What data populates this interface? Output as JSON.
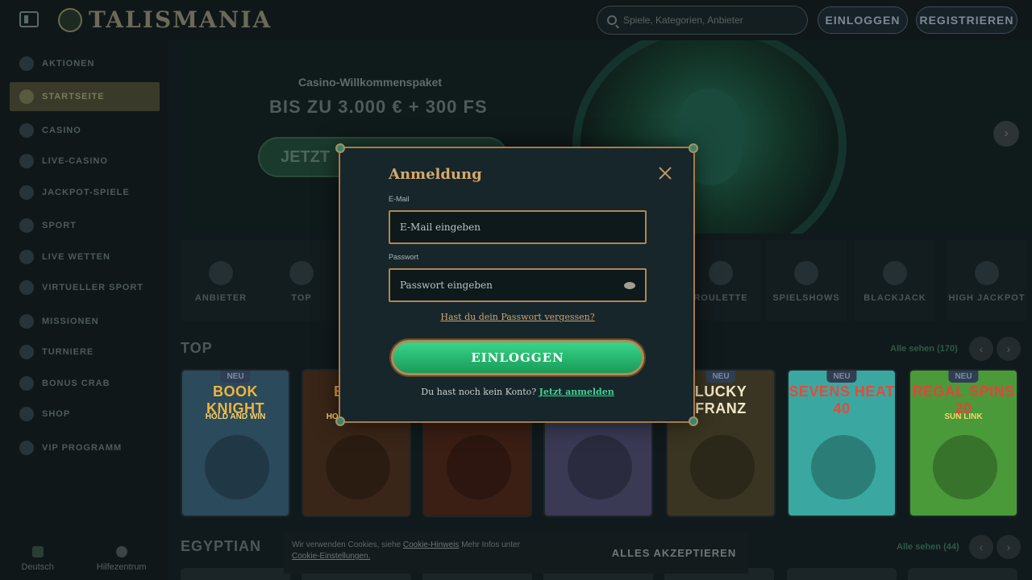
{
  "header": {
    "brand": "TALISMANIA",
    "search_placeholder": "Spiele, Kategorien, Anbieter",
    "login_label": "EINLOGGEN",
    "register_label": "REGISTRIEREN"
  },
  "sidebar": {
    "items": [
      {
        "label": "AKTIONEN",
        "icon": "gift-icon"
      },
      {
        "label": "STARTSEITE",
        "icon": "home-icon",
        "active": true
      },
      {
        "label": "CASINO",
        "icon": "casino-icon"
      },
      {
        "label": "LIVE-CASINO",
        "icon": "live-casino-icon"
      },
      {
        "label": "JACKPOT-SPIELE",
        "icon": "jackpot-icon"
      },
      {
        "label": "SPORT",
        "icon": "sport-icon"
      },
      {
        "label": "LIVE WETTEN",
        "icon": "live-bet-icon"
      },
      {
        "label": "VIRTUELLER SPORT",
        "icon": "virtual-sport-icon"
      },
      {
        "label": "MISSIONEN",
        "icon": "missions-icon"
      },
      {
        "label": "TURNIERE",
        "icon": "trophy-icon"
      },
      {
        "label": "BONUS CRAB",
        "icon": "crab-icon"
      },
      {
        "label": "SHOP",
        "icon": "shop-icon"
      },
      {
        "label": "VIP PROGRAMM",
        "icon": "diamond-icon"
      }
    ],
    "footer": {
      "language": "Deutsch",
      "help": "Hilfezentrum"
    }
  },
  "hero": {
    "subtitle": "Casino-Willkommenspaket",
    "title": "BIS ZU 3.000 € + 300 FS",
    "cta": "JETZT"
  },
  "categories": [
    {
      "label": "ANBIETER"
    },
    {
      "label": "TOP"
    },
    {
      "label": "ROULETTE"
    },
    {
      "label": "SPIELSHOWS"
    },
    {
      "label": "BLACKJACK"
    },
    {
      "label": "HIGH JACKPOT"
    }
  ],
  "top_section": {
    "title": "TOP",
    "see_all": "Alle sehen (170)"
  },
  "games": [
    {
      "badge": "NEU",
      "name": "BOOK KNIGHT",
      "sub": "HOLD AND WIN",
      "bg": "#2b4a5c",
      "name_color": "#f0b43b"
    },
    {
      "badge": "",
      "name": "BOOK",
      "sub": "HOLD AND WIN",
      "bg": "#3a2618",
      "name_color": "#e0a040"
    },
    {
      "badge": "",
      "name": "",
      "sub": "",
      "bg": "#3b1e14",
      "name_color": "#d08040"
    },
    {
      "badge": "",
      "name": "",
      "sub": "",
      "bg": "#3a3a55",
      "name_color": "#c0c0e0"
    },
    {
      "badge": "NEU",
      "name": "LUCKY FRANZ",
      "sub": "",
      "bg": "#3a3522",
      "name_color": "#f2e7c8"
    },
    {
      "badge": "NEU",
      "name": "SEVENS HEAT 40",
      "sub": "",
      "bg": "#3aa8a0",
      "name_color": "#e54a3a"
    },
    {
      "badge": "NEU",
      "name": "REGAL SPINS 20",
      "sub": "SUN LINK",
      "bg": "#4a9a3a",
      "name_color": "#e8423a"
    }
  ],
  "egyptian_section": {
    "title": "EGYPTIAN",
    "see_all": "Alle sehen (44)"
  },
  "cookie": {
    "text_prefix": "Wir verwenden Cookies, siehe",
    "link1": "Cookie-Hinweis",
    "text_mid": "Mehr Infos unter",
    "link2": "Cookie-Einstellungen.",
    "accept": "ALLES AKZEPTIEREN"
  },
  "login_modal": {
    "title": "Anmeldung",
    "email_label": "E-Mail",
    "email_placeholder": "E-Mail eingeben",
    "email_value": "",
    "password_label": "Passwort",
    "password_placeholder": "Passwort eingeben",
    "password_value": "",
    "forgot": "Hast du dein Passwort vergessen?",
    "submit": "EINLOGGEN",
    "no_account": "Du hast noch kein Konto?",
    "register_link": "Jetzt anmelden"
  },
  "colors": {
    "accent_gold": "#b08651",
    "accent_green": "#2fc47c",
    "modal_bg": "#16262a"
  }
}
